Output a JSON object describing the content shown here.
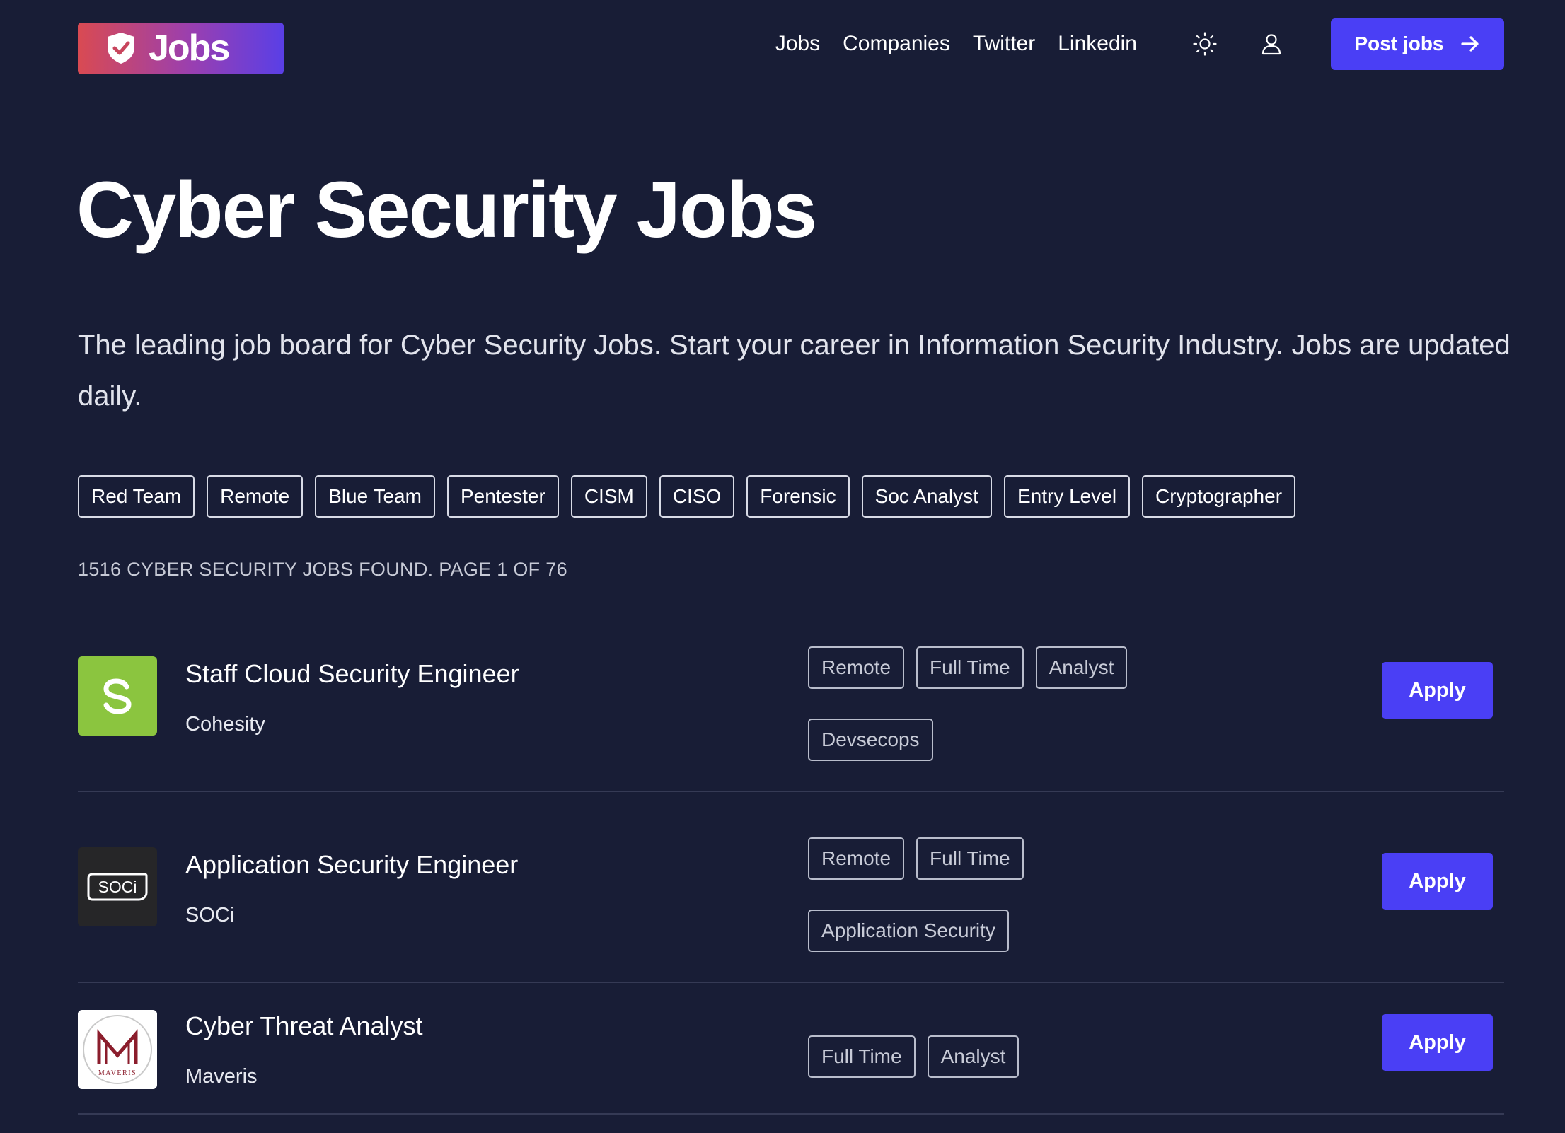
{
  "header": {
    "logo_text": "Jobs",
    "nav": [
      "Jobs",
      "Companies",
      "Twitter",
      "Linkedin"
    ],
    "post_button": "Post jobs"
  },
  "hero": {
    "title": "Cyber Security Jobs",
    "subtitle": "The leading job board for Cyber Security Jobs. Start your career in Information Security Industry. Jobs are updated daily."
  },
  "filters": [
    "Red Team",
    "Remote",
    "Blue Team",
    "Pentester",
    "CISM",
    "CISO",
    "Forensic",
    "Soc Analyst",
    "Entry Level",
    "Cryptographer"
  ],
  "results": {
    "count_text": "1516 CYBER SECURITY JOBS FOUND. PAGE 1 OF 76"
  },
  "jobs": [
    {
      "title": "Staff Cloud Security Engineer",
      "company": "Cohesity",
      "logo_icon": "cohesity-logo",
      "tags": [
        "Remote",
        "Full Time",
        "Analyst",
        "Devsecops"
      ],
      "apply": "Apply"
    },
    {
      "title": "Application Security Engineer",
      "company": "SOCi",
      "logo_icon": "soci-logo",
      "logo_text": "SOCi",
      "tags": [
        "Remote",
        "Full Time",
        "Application Security"
      ],
      "apply": "Apply"
    },
    {
      "title": "Cyber Threat Analyst",
      "company": "Maveris",
      "logo_icon": "maveris-logo",
      "logo_text": "MAVERIS",
      "tags": [
        "Full Time",
        "Analyst"
      ],
      "apply": "Apply"
    }
  ],
  "colors": {
    "background": "#181d36",
    "accent": "#4a3ff5",
    "cohesity_green": "#8bc53f"
  },
  "icons": {
    "logo": "shield-check-icon",
    "theme_toggle": "sun-icon",
    "account": "user-icon",
    "post_arrow": "arrow-right-icon"
  }
}
